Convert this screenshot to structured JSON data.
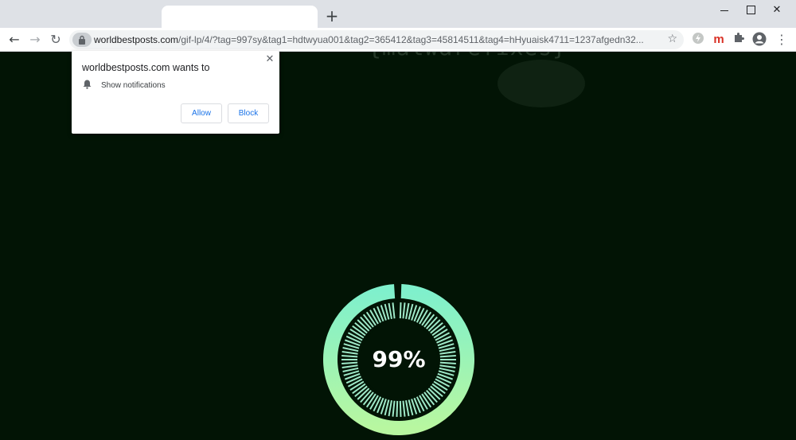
{
  "browser": {
    "tab_title": "",
    "new_tab_glyph": "+",
    "window_controls": {
      "close_glyph": "✕"
    },
    "nav": {
      "back_glyph": "←",
      "forward_glyph": "→",
      "reload_glyph": "↻"
    },
    "address": {
      "domain": "worldbestposts.com",
      "path": "/gif-lp/4/?tag=997sy&tag1=hdtwyua001&tag2=365412&tag3=45814511&tag4=hHyuaisk4711=1237afgedn32..."
    },
    "star_glyph": "☆",
    "extensions": {
      "m_label": "m",
      "puzzle_glyph": "✚",
      "menu_glyph": "⋮"
    }
  },
  "watermark": {
    "text": "{malwarefixes}"
  },
  "permission_popup": {
    "title": "worldbestposts.com wants to",
    "permission": "Show notifications",
    "close_glyph": "✕",
    "allow_label": "Allow",
    "block_label": "Block"
  },
  "loader": {
    "percent_text": "99%",
    "progress": 0.99,
    "colors": {
      "outer_ring_top": "#7ff0cc",
      "outer_ring_bottom": "#b8f7a0",
      "ticks": "#9fe8c8",
      "center": "#021405"
    }
  },
  "colors": {
    "page_background": "#021405",
    "tab_strip": "#dee1e6",
    "accent_blue": "#1a73e8"
  }
}
